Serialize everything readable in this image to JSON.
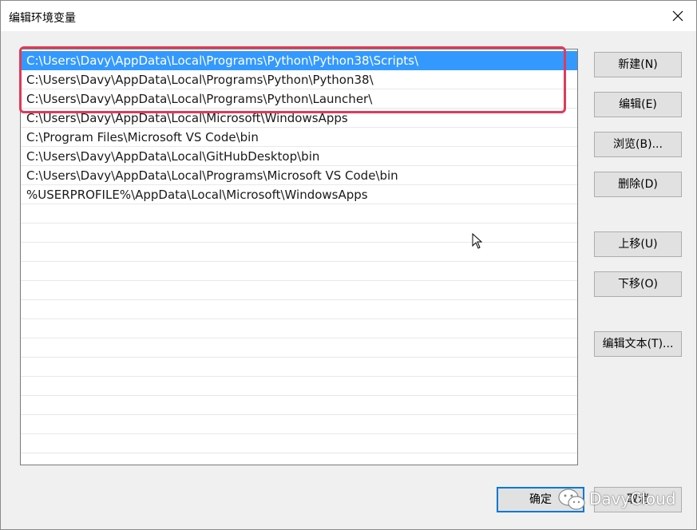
{
  "window": {
    "title": "编辑环境变量"
  },
  "list": {
    "selected_index": 0,
    "items": [
      "C:\\Users\\Davy\\AppData\\Local\\Programs\\Python\\Python38\\Scripts\\",
      "C:\\Users\\Davy\\AppData\\Local\\Programs\\Python\\Python38\\",
      "C:\\Users\\Davy\\AppData\\Local\\Programs\\Python\\Launcher\\",
      "C:\\Users\\Davy\\AppData\\Local\\Microsoft\\WindowsApps",
      "C:\\Program Files\\Microsoft VS Code\\bin",
      "C:\\Users\\Davy\\AppData\\Local\\GitHubDesktop\\bin",
      "C:\\Users\\Davy\\AppData\\Local\\Programs\\Microsoft VS Code\\bin",
      "%USERPROFILE%\\AppData\\Local\\Microsoft\\WindowsApps"
    ]
  },
  "buttons": {
    "new": "新建(N)",
    "edit": "编辑(E)",
    "browse": "浏览(B)...",
    "delete": "删除(D)",
    "move_up": "上移(U)",
    "move_down": "下移(O)",
    "edit_text": "编辑文本(T)...",
    "ok": "确定",
    "cancel": "取消"
  },
  "watermark": {
    "text": "DavyCloud"
  },
  "colors": {
    "selection": "#3399ff",
    "highlight_border": "#e03a5a",
    "default_button_border": "#0078d7"
  }
}
